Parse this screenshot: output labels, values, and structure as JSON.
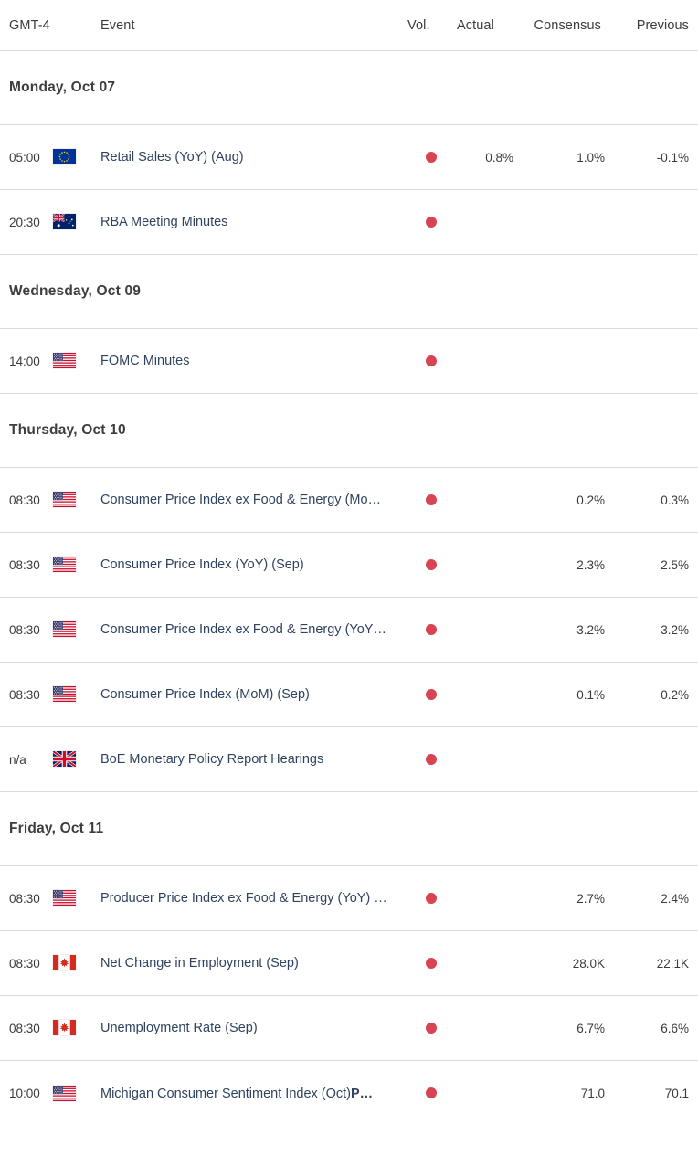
{
  "header": {
    "timezone": "GMT-4",
    "event": "Event",
    "vol": "Vol.",
    "actual": "Actual",
    "consensus": "Consensus",
    "previous": "Previous"
  },
  "colors": {
    "volatility_high": "#d94452",
    "event_link": "#2f4360",
    "row_divider": "#dcdcdc",
    "text": "#3b3b3b"
  },
  "groups": [
    {
      "date": "Monday, Oct 07",
      "rows": [
        {
          "time": "05:00",
          "flag": "eu-flag",
          "event": "Retail Sales (YoY) (Aug)",
          "tag": "",
          "volatility": "high",
          "actual": "0.8%",
          "consensus": "1.0%",
          "previous": "-0.1%"
        },
        {
          "time": "20:30",
          "flag": "au-flag",
          "event": "RBA Meeting Minutes",
          "tag": "",
          "volatility": "high",
          "actual": "",
          "consensus": "",
          "previous": ""
        }
      ]
    },
    {
      "date": "Wednesday, Oct 09",
      "rows": [
        {
          "time": "14:00",
          "flag": "us-flag",
          "event": "FOMC Minutes",
          "tag": "",
          "volatility": "high",
          "actual": "",
          "consensus": "",
          "previous": ""
        }
      ]
    },
    {
      "date": "Thursday, Oct 10",
      "rows": [
        {
          "time": "08:30",
          "flag": "us-flag",
          "event": "Consumer Price Index ex Food & Energy (Mo…",
          "tag": "",
          "volatility": "high",
          "actual": "",
          "consensus": "0.2%",
          "previous": "0.3%"
        },
        {
          "time": "08:30",
          "flag": "us-flag",
          "event": "Consumer Price Index (YoY) (Sep)",
          "tag": "",
          "volatility": "high",
          "actual": "",
          "consensus": "2.3%",
          "previous": "2.5%"
        },
        {
          "time": "08:30",
          "flag": "us-flag",
          "event": "Consumer Price Index ex Food & Energy (YoY…",
          "tag": "",
          "volatility": "high",
          "actual": "",
          "consensus": "3.2%",
          "previous": "3.2%"
        },
        {
          "time": "08:30",
          "flag": "us-flag",
          "event": "Consumer Price Index (MoM) (Sep)",
          "tag": "",
          "volatility": "high",
          "actual": "",
          "consensus": "0.1%",
          "previous": "0.2%"
        },
        {
          "time": "n/a",
          "flag": "gb-flag",
          "event": "BoE Monetary Policy Report Hearings",
          "tag": "",
          "volatility": "high",
          "actual": "",
          "consensus": "",
          "previous": ""
        }
      ]
    },
    {
      "date": "Friday, Oct 11",
      "rows": [
        {
          "time": "08:30",
          "flag": "us-flag",
          "event": "Producer Price Index ex Food & Energy (YoY) …",
          "tag": "",
          "volatility": "high",
          "actual": "",
          "consensus": "2.7%",
          "previous": "2.4%"
        },
        {
          "time": "08:30",
          "flag": "ca-flag",
          "event": "Net Change in Employment (Sep)",
          "tag": "",
          "volatility": "high",
          "actual": "",
          "consensus": "28.0K",
          "previous": "22.1K"
        },
        {
          "time": "08:30",
          "flag": "ca-flag",
          "event": "Unemployment Rate (Sep)",
          "tag": "",
          "volatility": "high",
          "actual": "",
          "consensus": "6.7%",
          "previous": "6.6%"
        },
        {
          "time": "10:00",
          "flag": "us-flag",
          "event": "Michigan Consumer Sentiment Index (Oct)",
          "tag": "P…",
          "volatility": "high",
          "actual": "",
          "consensus": "71.0",
          "previous": "70.1"
        }
      ]
    }
  ]
}
